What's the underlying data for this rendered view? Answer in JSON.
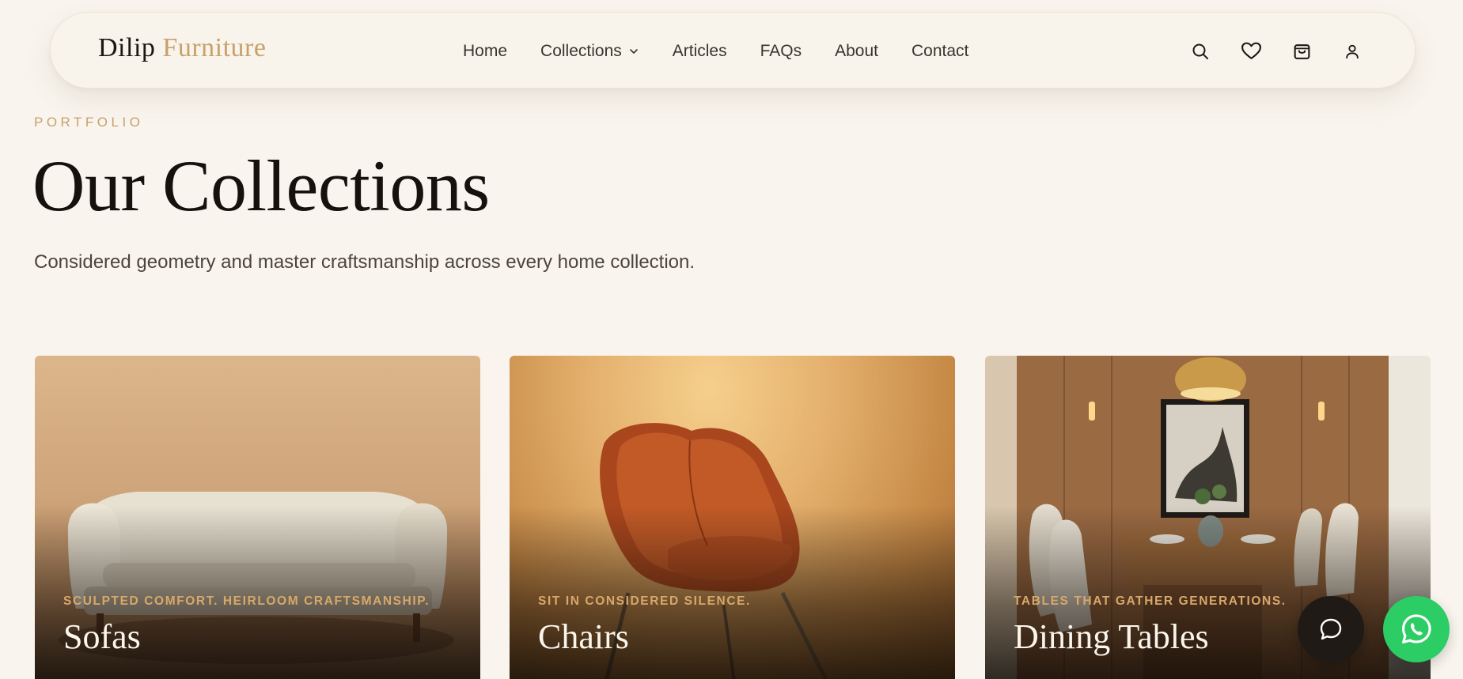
{
  "brand": {
    "name_first": "Dilip",
    "name_second": "Furniture",
    "accent_color": "#c9a06a"
  },
  "nav": {
    "items": [
      {
        "label": "Home"
      },
      {
        "label": "Collections",
        "has_dropdown": true
      },
      {
        "label": "Articles"
      },
      {
        "label": "FAQs"
      },
      {
        "label": "About"
      },
      {
        "label": "Contact"
      }
    ],
    "icons": [
      "search-icon",
      "heart-icon",
      "shopping-bag-icon",
      "user-icon"
    ]
  },
  "hero": {
    "eyebrow": "PORTFOLIO",
    "title": "Our Collections",
    "subtitle": "Considered geometry and master craftsmanship across every home collection."
  },
  "collections": [
    {
      "tagline": "SCULPTED COMFORT. HEIRLOOM CRAFTSMANSHIP.",
      "title": "Sofas"
    },
    {
      "tagline": "SIT IN CONSIDERED SILENCE.",
      "title": "Chairs"
    },
    {
      "tagline": "TABLES THAT GATHER GENERATIONS.",
      "title": "Dining Tables"
    }
  ],
  "floating": {
    "chat_icon": "chat-bubble-icon",
    "whatsapp_icon": "whatsapp-icon",
    "whatsapp_color": "#2ccd64"
  }
}
